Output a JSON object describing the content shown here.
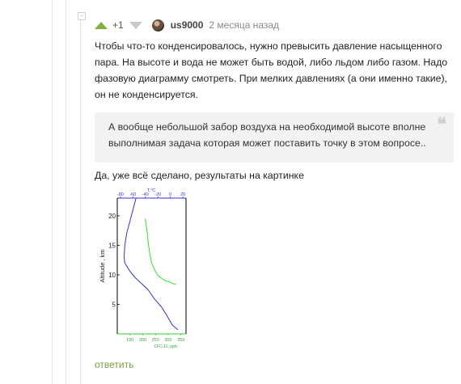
{
  "comment": {
    "rating": "+1",
    "username": "us9000",
    "time": "2 месяца назад",
    "paragraph1": "Чтобы что-то конденсировалось, нужно превысить давление насыщенного пара. На высоте и вода не может быть водой, либо льдом либо газом. Надо фазовую диаграмму смотреть. При мелких давлениях (а они именно такие), он не конденсируется.",
    "quote": "А вообще небольшой забор воздуха на необходимой высоте вполне выполнимая задача которая может поставить точку в этом вопросе..",
    "quote_mark": "❝",
    "paragraph2": "Да, уже всё сделано, результаты на картинке",
    "reply_label": "ответить"
  },
  "icons": {
    "vote_up": "vote-up-icon",
    "vote_down": "vote-down-icon",
    "collapse": "collapse-icon"
  },
  "colors": {
    "accent": "#7db33b",
    "reply": "#7aa03a",
    "temp_line": "#3333cc",
    "cfc_line": "#33dd33"
  },
  "chart_data": {
    "type": "line",
    "top_axis_label": "T,°C",
    "top_ticks": [
      "-80",
      "-60",
      "-40",
      "-20",
      "0",
      "20"
    ],
    "top_tick_values": [
      -80,
      -60,
      -40,
      -20,
      0,
      20
    ],
    "bottom_axis_label": "CFC-11, pptv",
    "bottom_ticks": [
      "150",
      "200",
      "250",
      "300",
      "350"
    ],
    "bottom_tick_values": [
      150,
      200,
      250,
      300,
      350
    ],
    "ylabel": "Altitude , km",
    "y_ticks": [
      "20",
      "15",
      "10",
      "5"
    ],
    "y_tick_values": [
      20,
      15,
      10,
      5
    ],
    "ylim": [
      0,
      23
    ],
    "temp_xlim": [
      -85,
      25
    ],
    "cfc_xlim": [
      100,
      370
    ],
    "series": [
      {
        "x": [
          -55,
          -60,
          -65,
          -70,
          -73,
          -74,
          -73,
          -70,
          -64,
          -56,
          -46,
          -36,
          -26,
          -14,
          -8,
          -5,
          3,
          12
        ],
        "y": [
          23,
          21,
          19,
          17,
          15,
          13,
          12,
          11.5,
          10.5,
          9.5,
          8.5,
          7.5,
          6,
          4.5,
          3.5,
          3,
          1.5,
          0.7
        ]
      },
      {
        "x": [
          210,
          213,
          218,
          223,
          228,
          235,
          245,
          258,
          272,
          288,
          305,
          320,
          330
        ],
        "y": [
          19.5,
          18.5,
          17,
          15,
          13.5,
          12,
          11,
          10,
          9.5,
          9,
          8.8,
          8.5,
          8.4
        ]
      }
    ]
  }
}
